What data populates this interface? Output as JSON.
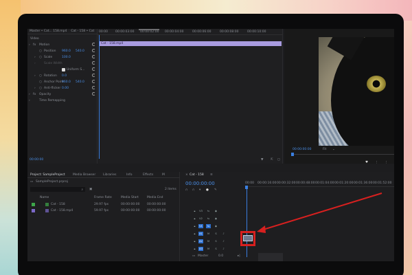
{
  "effect_controls": {
    "tabs": [
      "Master • Cat... 158.mp4",
      "Cat - 158 • Cat"
    ],
    "video_label": "Video",
    "motion": "Motion",
    "rows": [
      {
        "label": "Position",
        "v1": "960.0",
        "v2": "540.0"
      },
      {
        "label": "Scale",
        "v1": "100.0",
        "v2": ""
      },
      {
        "label": "Scale Width",
        "v1": "",
        "v2": ""
      },
      {
        "label": "Uniform S...",
        "v1": "",
        "v2": ""
      },
      {
        "label": "Rotation",
        "v1": "0.0",
        "v2": ""
      },
      {
        "label": "Anchor Point",
        "v1": "960.0",
        "v2": "540.0"
      },
      {
        "label": "Anti-flicker",
        "v1": "0.00",
        "v2": ""
      },
      {
        "label": "Opacity",
        "v1": "",
        "v2": ""
      },
      {
        "label": "Time Remapping",
        "v1": "",
        "v2": ""
      }
    ],
    "timecode": "00:00:00",
    "ruler": [
      "00:00",
      "00:00:03:00",
      "00:00:02:00",
      "00:00:04:00",
      "00:00:06:00",
      "00:00:08:00",
      "00:00:10:00"
    ],
    "clip_label": "Cat - 158.mp4"
  },
  "program": {
    "timecode": "00:00:00:00",
    "fit": "Fit"
  },
  "project": {
    "tabs": [
      "Project: SampleProject",
      "Media Browser",
      "Libraries",
      "Info",
      "Effects",
      "M"
    ],
    "file": "SampleProject.prproj",
    "items_count": "2 items",
    "headers": [
      "Name",
      "Frame Rate",
      "Media Start",
      "Media End"
    ],
    "rows": [
      {
        "name": "Cat - 158",
        "rate": "29.97 fps",
        "start": "00:00:00:00",
        "end": "00:00:00:00",
        "color": "#3da64a"
      },
      {
        "name": "Cat - 158.mp4",
        "rate": "59.97 fps",
        "start": "00:00:00:00",
        "end": "00:00:00:00",
        "color": "#7b68c8"
      }
    ]
  },
  "timeline": {
    "tab": "Cat - 158",
    "timecode": "00:00:00:00",
    "ruler": [
      "00:00",
      "00:00:16:00",
      "00:00:32:00",
      "00:00:48:00",
      "00:01:04:00",
      "00:01:20:00",
      "00:01:36:00",
      "00:01:52:00"
    ],
    "tracks": [
      "V3",
      "V2",
      "V1",
      "A1",
      "A2",
      "A3"
    ],
    "mix": "Master",
    "mix_val": "0.0"
  },
  "colors": {
    "accent": "#4a8fe8",
    "clip": "#a99ce0",
    "highlight": "#d8201f"
  }
}
